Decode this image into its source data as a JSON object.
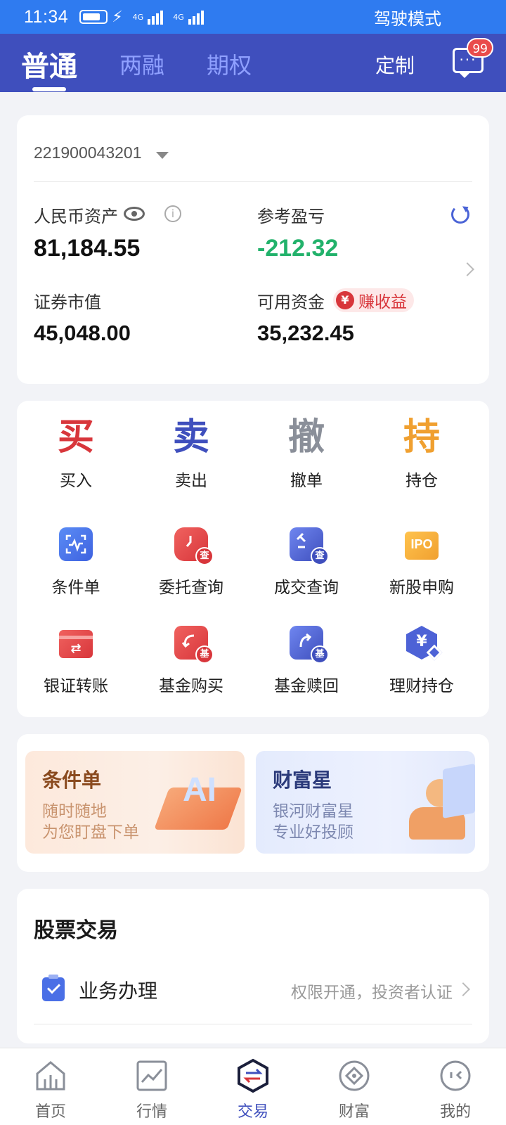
{
  "status_bar": {
    "time": "11:34",
    "net1": "4G",
    "net2": "4G",
    "mode": "驾驶模式"
  },
  "header": {
    "tabs": [
      "普通",
      "两融",
      "期权"
    ],
    "custom_label": "定制",
    "message_badge": "99"
  },
  "account": {
    "number": "221900043201",
    "rmb_assets_label": "人民币资产",
    "rmb_assets_value": "81,184.55",
    "pnl_label": "参考盈亏",
    "pnl_value": "-212.32",
    "market_value_label": "证券市值",
    "market_value": "45,048.00",
    "available_label": "可用资金",
    "available_value": "35,232.45",
    "earn_badge": "赚收益",
    "earn_icon_char": "¥",
    "info_char": "i"
  },
  "actions": {
    "buy": {
      "glyph": "买",
      "label": "买入",
      "color": "#d8363b"
    },
    "sell": {
      "glyph": "卖",
      "label": "卖出",
      "color": "#3f4fbd"
    },
    "cancel": {
      "glyph": "撤",
      "label": "撤单",
      "color": "#8a8f99"
    },
    "hold": {
      "glyph": "持",
      "label": "持仓",
      "color": "#f0a030"
    },
    "conditional": {
      "label": "条件单"
    },
    "order_query": {
      "label": "委托查询",
      "sub": "查"
    },
    "deal_query": {
      "label": "成交查询",
      "sub": "查"
    },
    "ipo": {
      "label": "新股申购",
      "icon_text": "IPO"
    },
    "bank_transfer": {
      "label": "银证转账"
    },
    "fund_buy": {
      "label": "基金购买",
      "sub": "基"
    },
    "fund_redeem": {
      "label": "基金赎回",
      "sub": "基"
    },
    "wealth_hold": {
      "label": "理财持仓",
      "icon_text": "¥"
    }
  },
  "banners": [
    {
      "title": "条件单",
      "line1": "随时随地",
      "line2": "为您盯盘下单",
      "art_text": "AI"
    },
    {
      "title": "财富星",
      "line1": "银河财富星",
      "line2": "专业好投顾"
    }
  ],
  "stock_trade": {
    "title": "股票交易",
    "item_label": "业务办理",
    "item_desc": "权限开通，投资者认证"
  },
  "bottom_nav": [
    "首页",
    "行情",
    "交易",
    "财富",
    "我的"
  ],
  "colors": {
    "primary": "#3f4fbd",
    "status_bar": "#2f7bf0",
    "red": "#d8363b",
    "green": "#22b26b"
  }
}
